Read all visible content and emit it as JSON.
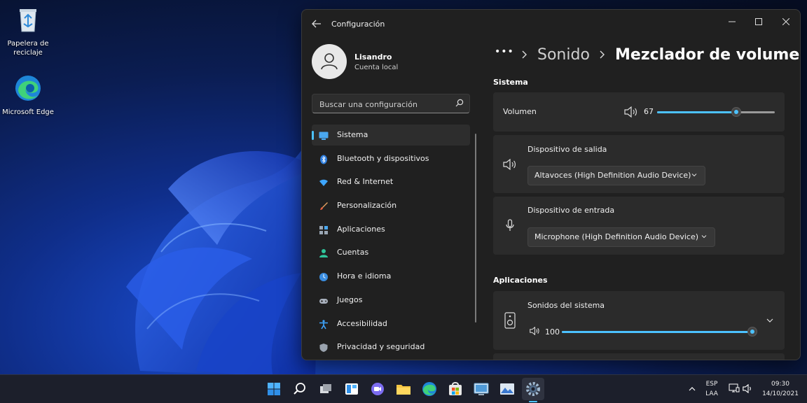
{
  "desktop": {
    "icons": [
      {
        "label": "Papelera de reciclaje"
      },
      {
        "label": "Microsoft Edge"
      }
    ]
  },
  "window": {
    "title": "Configuración",
    "profile": {
      "name": "Lisandro",
      "account": "Cuenta local"
    },
    "search": {
      "placeholder": "Buscar una configuración"
    },
    "nav": [
      {
        "label": "Sistema",
        "icon": "monitor-icon",
        "active": true
      },
      {
        "label": "Bluetooth y dispositivos",
        "icon": "bluetooth-icon"
      },
      {
        "label": "Red & Internet",
        "icon": "wifi-icon"
      },
      {
        "label": "Personalización",
        "icon": "brush-icon"
      },
      {
        "label": "Aplicaciones",
        "icon": "apps-icon"
      },
      {
        "label": "Cuentas",
        "icon": "person-icon"
      },
      {
        "label": "Hora e idioma",
        "icon": "clock-globe-icon"
      },
      {
        "label": "Juegos",
        "icon": "gamepad-icon"
      },
      {
        "label": "Accesibilidad",
        "icon": "accessibility-icon"
      },
      {
        "label": "Privacidad y seguridad",
        "icon": "shield-icon"
      }
    ],
    "breadcrumb": {
      "more": "•••",
      "parent": "Sonido",
      "current": "Mezclador de volumen"
    },
    "sistema": {
      "title": "Sistema",
      "volume": {
        "label": "Volumen",
        "value": "67",
        "level": 0.67
      },
      "output": {
        "label": "Dispositivo de salida",
        "selected": "Altavoces (High Definition Audio Device)"
      },
      "input": {
        "label": "Dispositivo de entrada",
        "selected": "Microphone (High Definition Audio Device)"
      }
    },
    "apps": {
      "title": "Aplicaciones",
      "system_sounds": {
        "label": "Sonidos del sistema",
        "value": "100",
        "level": 1.0
      }
    }
  },
  "taskbar": {
    "icons": [
      "start-icon",
      "search-icon",
      "task-view-icon",
      "widgets-icon",
      "chat-icon",
      "file-explorer-icon",
      "edge-icon",
      "store-icon",
      "control-panel-icon",
      "photos-icon",
      "settings-icon"
    ],
    "tray": {
      "lang1": "ESP",
      "lang2": "LAA",
      "time": "09:30",
      "date": "14/10/2021"
    }
  },
  "colors": {
    "accent": "#4cc2ff",
    "window_bg": "#202020",
    "card_bg": "#2b2b2b"
  }
}
